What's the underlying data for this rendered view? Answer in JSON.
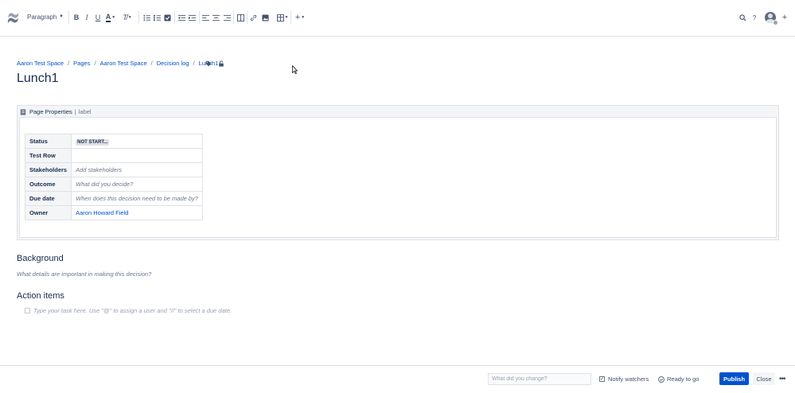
{
  "toolbar": {
    "paragraph_style": "Paragraph",
    "icons": [
      "confluence-logo",
      "bold",
      "italic",
      "underline",
      "text-color",
      "clear-formatting",
      "bullet-list",
      "numbered-list",
      "task-list",
      "outdent",
      "indent",
      "align-left",
      "align-center",
      "align-right",
      "page-layout",
      "link",
      "image",
      "table",
      "insert-more",
      "search",
      "help",
      "avatar",
      "add"
    ]
  },
  "breadcrumb": [
    "Aaron Test Space",
    "Pages",
    "Aaron Test Space",
    "Decision log",
    "Lunch1"
  ],
  "page": {
    "title": "Lunch1"
  },
  "macro": {
    "name": "Page Properties",
    "separator": "|",
    "label": "label"
  },
  "properties": [
    {
      "key": "Status",
      "value": "NOT START..."
    },
    {
      "key": "Test Row",
      "value": ""
    },
    {
      "key": "Stakeholders",
      "value": "Add stakeholders"
    },
    {
      "key": "Outcome",
      "value": "What did you decide?"
    },
    {
      "key": "Due date",
      "value": "When does this decision need to be made by?"
    },
    {
      "key": "Owner",
      "value": "Aaron Howard Field"
    }
  ],
  "sections": {
    "background_heading": "Background",
    "background_placeholder": "What details are important in making this decision?",
    "action_heading": "Action items",
    "task_placeholder": "Type your task here. Use \"@\" to assign a user and \"//\" to select a due date."
  },
  "footer": {
    "change_placeholder": "What did you change?",
    "notify_label": "Notify watchers",
    "ready_label": "Ready to go",
    "publish_label": "Publish",
    "close_label": "Close",
    "more_label": "•••"
  },
  "colors": {
    "primary": "#0052cc",
    "text": "#172b4d",
    "subtle": "#6b778c",
    "border": "#dfe1e6"
  }
}
